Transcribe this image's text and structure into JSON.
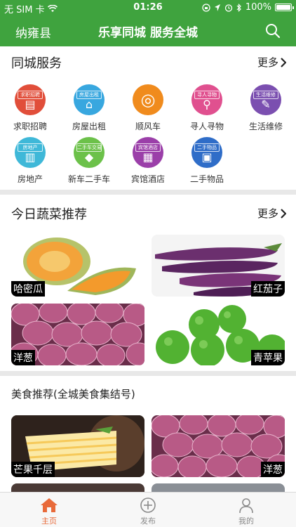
{
  "status_bar": {
    "carrier": "无 SIM 卡",
    "time": "01:26",
    "battery": "100%"
  },
  "nav": {
    "city": "纳雍县",
    "title": "乐享同城 服务全城"
  },
  "services": {
    "title": "同城服务",
    "more": "更多",
    "items": [
      {
        "label": "求职招聘",
        "tag": "求职招聘",
        "glyph": "▤",
        "color": "#e14e3a"
      },
      {
        "label": "房屋出租",
        "tag": "房屋出租",
        "glyph": "⌂",
        "color": "#38a7df"
      },
      {
        "label": "顺风车",
        "tag": "",
        "glyph": "◎",
        "color": "#f08b1d"
      },
      {
        "label": "寻人寻物",
        "tag": "寻人寻物",
        "glyph": "⚲",
        "color": "#e0508f"
      },
      {
        "label": "生活维修",
        "tag": "生活维修",
        "glyph": "✎",
        "color": "#7b4fb0"
      },
      {
        "label": "房地产",
        "tag": "房地产",
        "glyph": "▥",
        "color": "#3fb8d8"
      },
      {
        "label": "新车二手车",
        "tag": "二手车交易",
        "glyph": "◆",
        "color": "#6cc14a"
      },
      {
        "label": "宾馆酒店",
        "tag": "宾馆酒店",
        "glyph": "▦",
        "color": "#9b3fa9"
      },
      {
        "label": "二手物品",
        "tag": "二手物品",
        "glyph": "▣",
        "color": "#2f6dc8"
      }
    ]
  },
  "vegetables": {
    "title": "今日蔬菜推荐",
    "more": "更多",
    "items": [
      {
        "label": "哈密瓜",
        "caption_side": "left"
      },
      {
        "label": "红茄子",
        "caption_side": "right"
      },
      {
        "label": "洋葱",
        "caption_side": "left"
      },
      {
        "label": "青苹果",
        "caption_side": "right"
      }
    ]
  },
  "food": {
    "title": "美食推荐(全城美食集结号)",
    "items": [
      {
        "label": "芒果千层",
        "caption_side": "left"
      },
      {
        "label": "洋葱",
        "caption_side": "right"
      }
    ]
  },
  "tabs": [
    {
      "label": "主页",
      "icon": "home-icon",
      "active": true
    },
    {
      "label": "发布",
      "icon": "plus-circle-icon",
      "active": false
    },
    {
      "label": "我的",
      "icon": "user-icon",
      "active": false
    }
  ],
  "colors": {
    "brand_green": "#3fa33e",
    "tab_active": "#e86a3a"
  }
}
